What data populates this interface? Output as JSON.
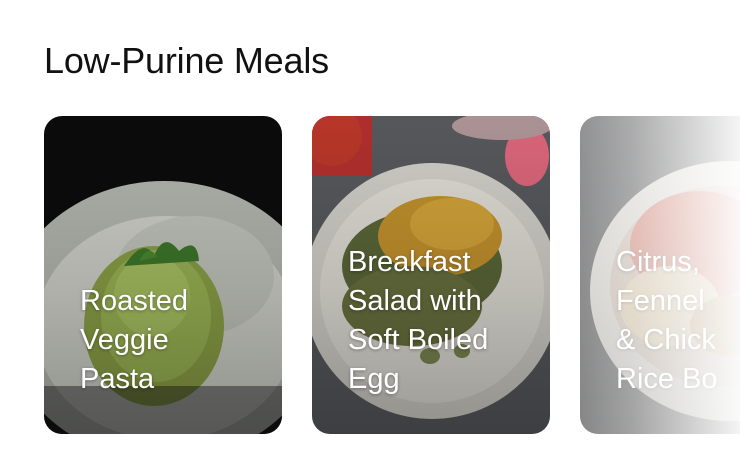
{
  "section": {
    "title": "Low-Purine Meals"
  },
  "cards": [
    {
      "title": "Roasted\nVeggie\nPasta",
      "image_icon": "pasta-photo"
    },
    {
      "title": "Breakfast\nSalad with\nSoft Boiled\nEgg",
      "image_icon": "salad-photo"
    },
    {
      "title": "Citrus,\nFennel\n& Chick\nRice Bo",
      "image_icon": "rice-bowl-photo"
    }
  ],
  "colors": {
    "title_text": "#111111",
    "card_text": "#ffffff"
  }
}
